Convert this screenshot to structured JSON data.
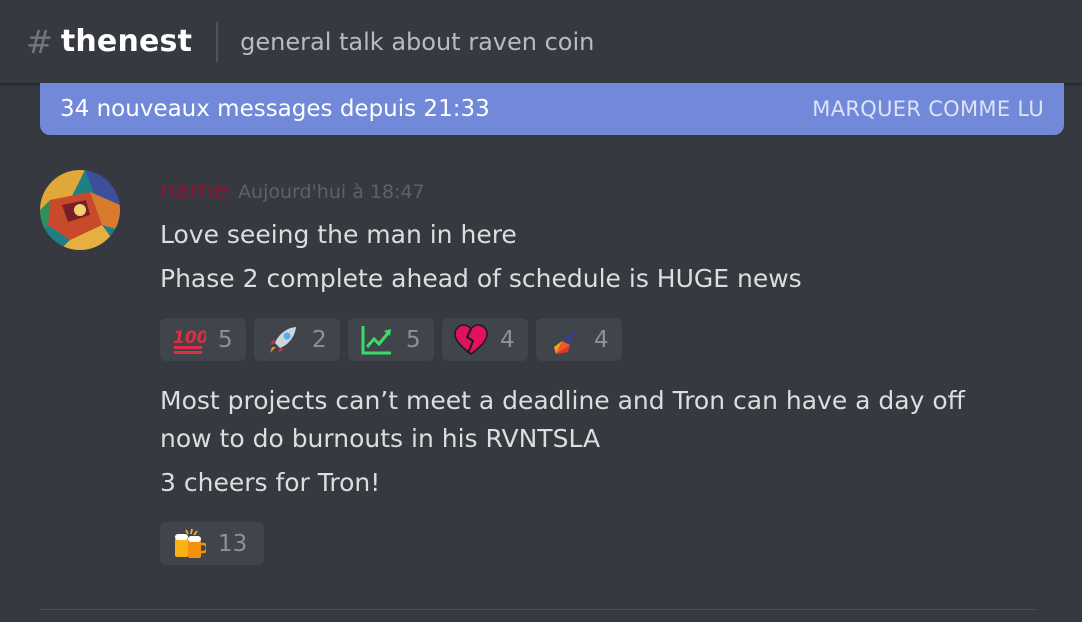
{
  "header": {
    "hash_glyph": "#",
    "channel_name": "thenest",
    "topic": "general talk about raven coin"
  },
  "banner": {
    "text": "34 nouveaux messages depuis 21:33",
    "mark_read_label": "MARQUER COMME LU",
    "color": "#7289da"
  },
  "message": {
    "author": "name",
    "author_color": "#8a1538",
    "timestamp": "Aujourd'hui à 18:47",
    "group1": {
      "lines": [
        "Love seeing the man in here",
        "Phase 2 complete ahead of schedule is HUGE news"
      ],
      "reactions": [
        {
          "icon": "hundred-points-icon",
          "count": "5"
        },
        {
          "icon": "rocket-icon",
          "count": "2"
        },
        {
          "icon": "chart-increasing-icon",
          "count": "5"
        },
        {
          "icon": "broken-heart-icon",
          "count": "4"
        },
        {
          "icon": "raven-logo-icon",
          "count": "4"
        }
      ]
    },
    "group2": {
      "lines": [
        "Most projects can’t meet a deadline and Tron can have a day off",
        "now to do burnouts in his RVNTSLA",
        "3 cheers for Tron!"
      ],
      "reactions": [
        {
          "icon": "clinking-beer-mugs-icon",
          "count": "13"
        }
      ]
    }
  }
}
